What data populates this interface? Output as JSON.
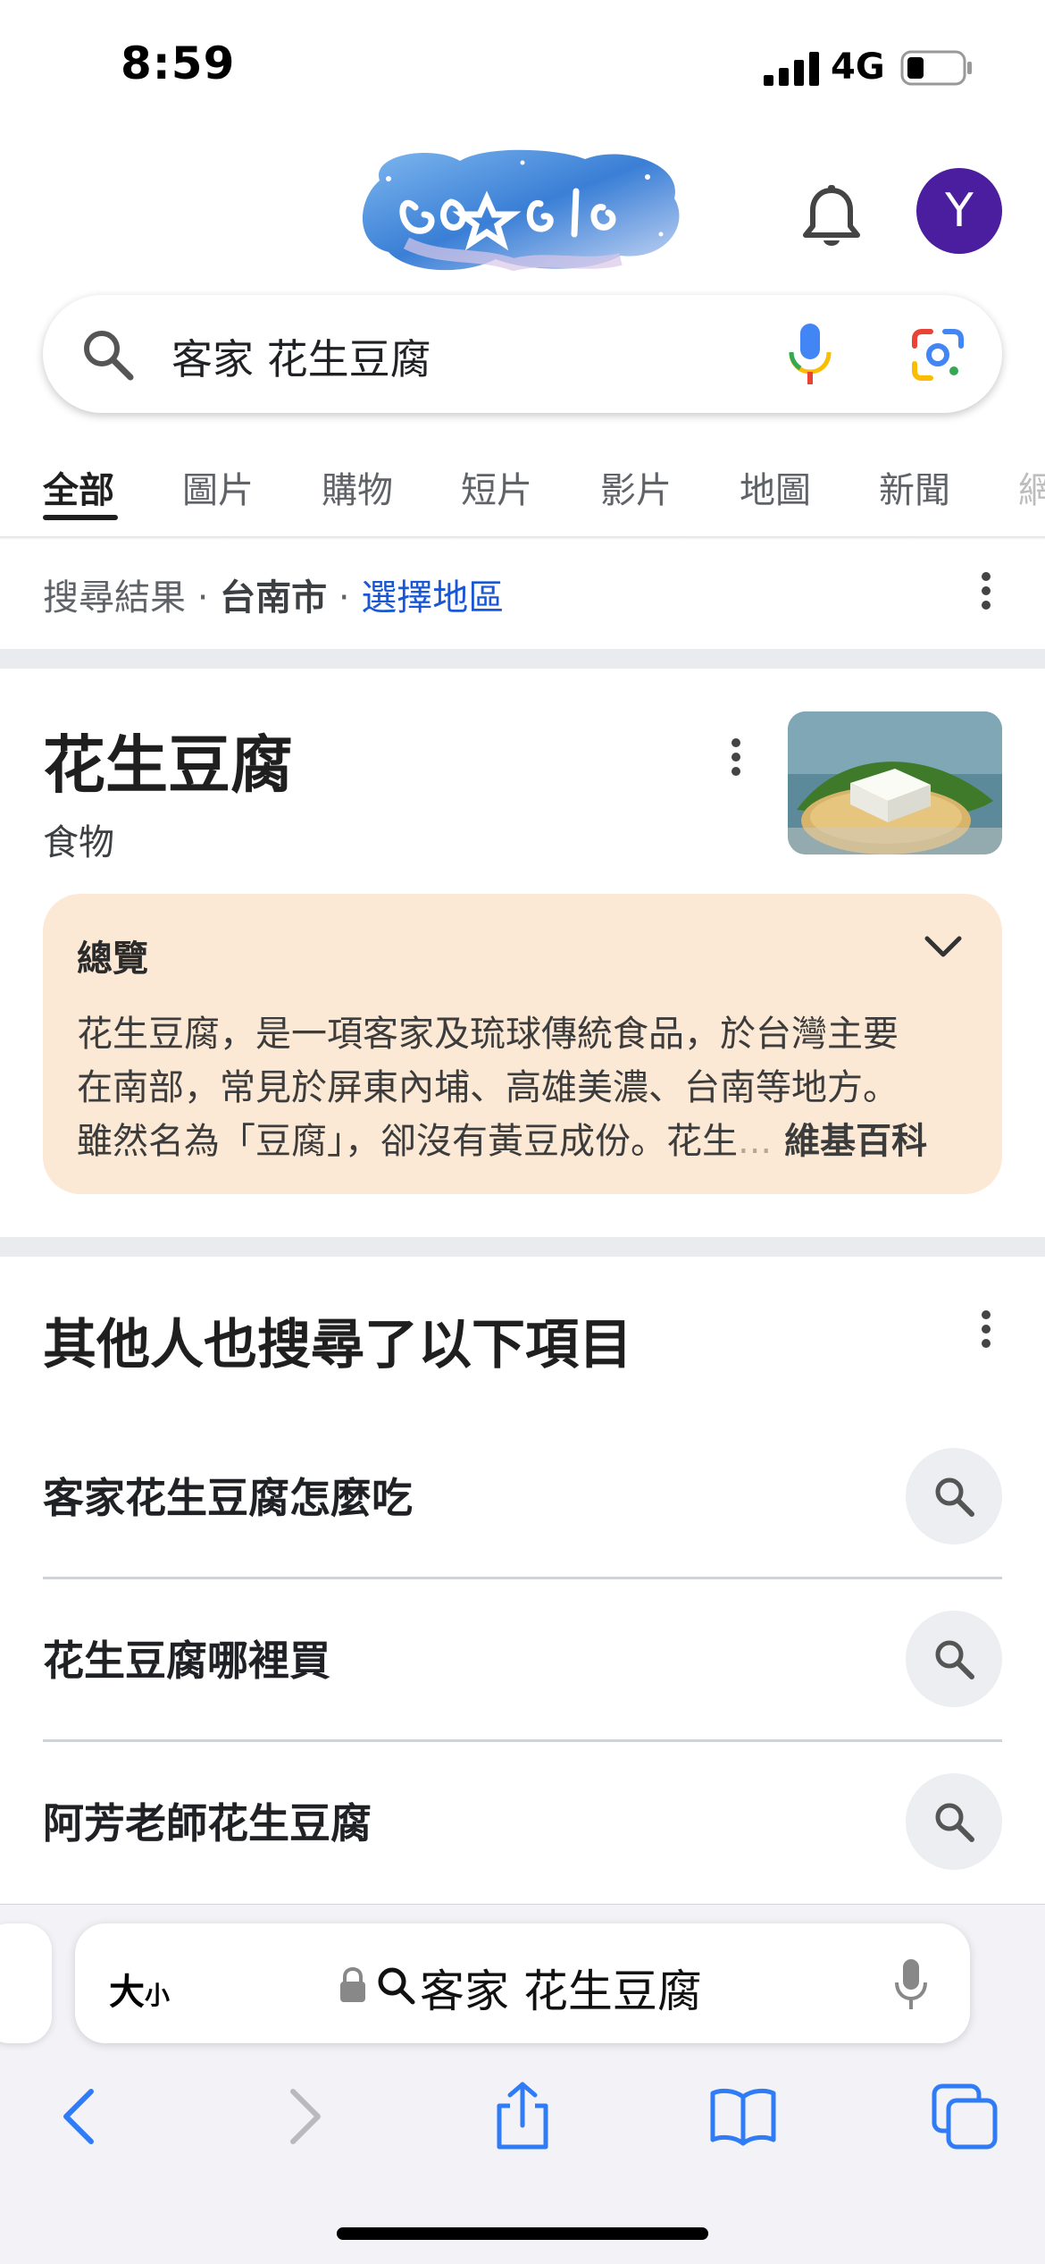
{
  "status_bar": {
    "time": "8:59",
    "network": "4G"
  },
  "header": {
    "avatar_letter": "Y"
  },
  "search": {
    "query": "客家 花生豆腐"
  },
  "tabs": [
    "全部",
    "圖片",
    "購物",
    "短片",
    "影片",
    "地圖",
    "新聞",
    "網"
  ],
  "location": {
    "prefix": "搜尋結果 · ",
    "city": "台南市",
    "separator": " · ",
    "link": "選擇地區"
  },
  "knowledge_panel": {
    "title": "花生豆腐",
    "subtitle": "食物",
    "overview_title": "總覽",
    "overview_lines": [
      "花生豆腐，是一項客家及琉球傳統食品，於台灣主要",
      "在南部，常見於屏東內埔、高雄美濃、台南等地方。",
      "雖然名為「豆腐」，卻沒有黃豆成份。花生"
    ],
    "overview_fade": "...",
    "overview_source": " 維基百科"
  },
  "people_also_search": {
    "title": "其他人也搜尋了以下項目",
    "items": [
      "客家花生豆腐怎麼吃",
      "花生豆腐哪裡買",
      "阿芳老師花生豆腐"
    ]
  },
  "safari": {
    "text_size_label": "大",
    "text_size_small": "小",
    "address_text": "客家 花生豆腐"
  },
  "colors": {
    "link": "#1a57d4",
    "overview_bg": "#fbe9d5",
    "avatar_bg": "#4a1e9e"
  }
}
